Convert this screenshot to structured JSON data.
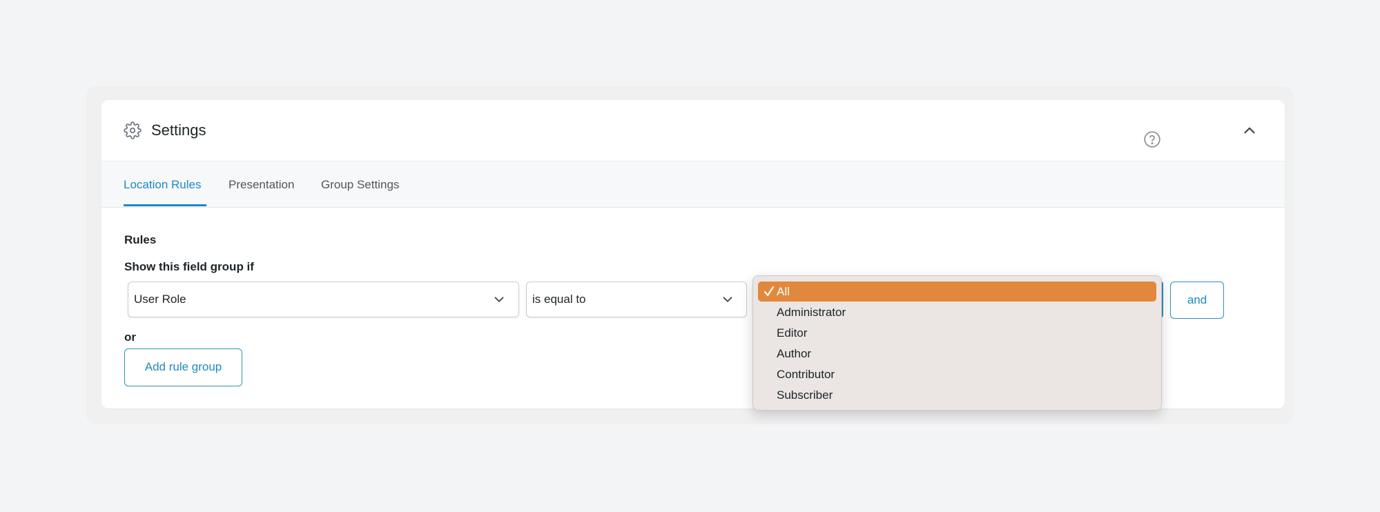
{
  "panel": {
    "title": "Settings",
    "icon": "gear-icon",
    "collapse_icon": "chevron-up-icon"
  },
  "tabs": [
    {
      "label": "Location Rules",
      "active": true
    },
    {
      "label": "Presentation",
      "active": false
    },
    {
      "label": "Group Settings",
      "active": false
    }
  ],
  "rules": {
    "heading": "Rules",
    "subheading": "Show this field group if",
    "help_icon": "question-circle-icon",
    "param_select": {
      "value": "User Role"
    },
    "operator_select": {
      "value": "is equal to"
    },
    "value_select": {
      "selected": "All",
      "options": [
        "All",
        "Administrator",
        "Editor",
        "Author",
        "Contributor",
        "Subscriber"
      ]
    },
    "and_label": "and",
    "or_label": "or",
    "add_group_label": "Add rule group"
  },
  "colors": {
    "accent": "#1d8ac0",
    "selected_option": "#e2883c",
    "dropdown_bg": "#ebe6e3"
  }
}
